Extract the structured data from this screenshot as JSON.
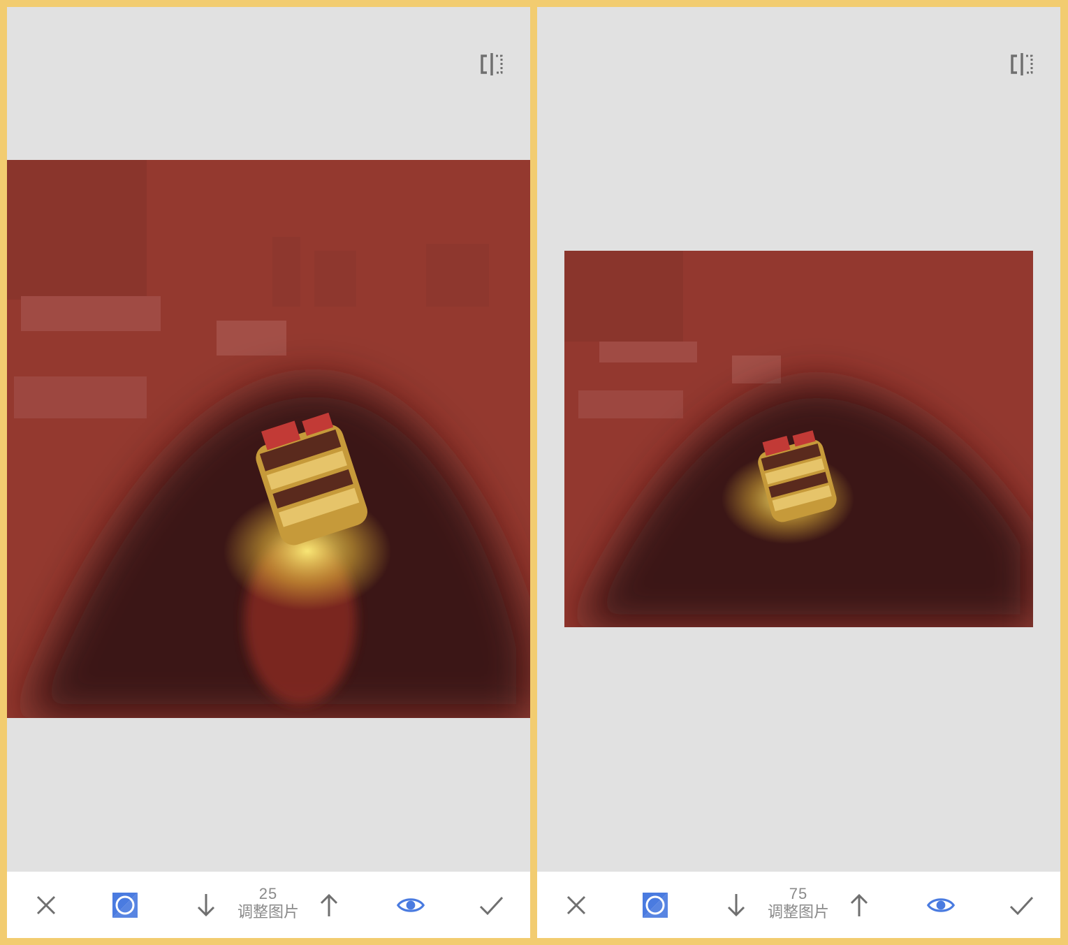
{
  "colors": {
    "frame": "#f2cc70",
    "canvas": "#e1e1e1",
    "toolbar": "#ffffff",
    "mask_overlay": "#9c3a33",
    "accent": "#4a7be0",
    "icon_gray": "#6f6f6f"
  },
  "panels": [
    {
      "toolbar": {
        "cancel_icon": "close-icon",
        "mask_icon": "mask-toggle-icon",
        "decrease_icon": "arrow-down-icon",
        "value": "25",
        "label": "调整图片",
        "increase_icon": "arrow-up-icon",
        "view_icon": "eye-icon",
        "apply_icon": "checkmark-icon"
      },
      "compare_icon": "compare-split-icon"
    },
    {
      "toolbar": {
        "cancel_icon": "close-icon",
        "mask_icon": "mask-toggle-icon",
        "decrease_icon": "arrow-down-icon",
        "value": "75",
        "label": "调整图片",
        "increase_icon": "arrow-up-icon",
        "view_icon": "eye-icon",
        "apply_icon": "checkmark-icon"
      },
      "compare_icon": "compare-split-icon"
    }
  ]
}
